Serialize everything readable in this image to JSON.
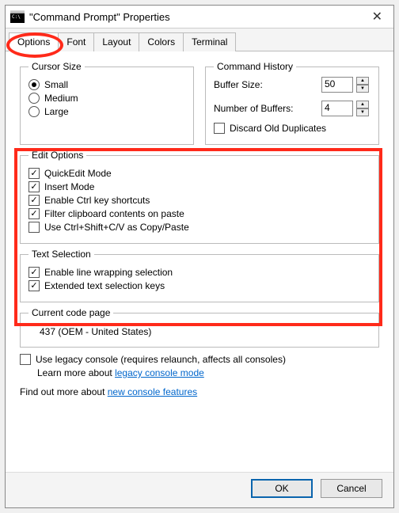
{
  "window": {
    "title": "\"Command Prompt\" Properties"
  },
  "tabs": {
    "options": "Options",
    "font": "Font",
    "layout": "Layout",
    "colors": "Colors",
    "terminal": "Terminal"
  },
  "cursor": {
    "legend": "Cursor Size",
    "small": "Small",
    "medium": "Medium",
    "large": "Large"
  },
  "history": {
    "legend": "Command History",
    "buffer_label": "Buffer Size:",
    "buffer_value": "50",
    "num_label": "Number of Buffers:",
    "num_value": "4",
    "discard": "Discard Old Duplicates"
  },
  "edit": {
    "legend": "Edit Options",
    "quickedit": "QuickEdit Mode",
    "insert": "Insert Mode",
    "ctrlkeys": "Enable Ctrl key shortcuts",
    "filter": "Filter clipboard contents on paste",
    "ctrlshift": "Use Ctrl+Shift+C/V as Copy/Paste"
  },
  "textsel": {
    "legend": "Text Selection",
    "wrap": "Enable line wrapping selection",
    "extended": "Extended text selection keys"
  },
  "codepage": {
    "legend": "Current code page",
    "value": "437   (OEM - United States)"
  },
  "legacy": {
    "checkbox": "Use legacy console (requires relaunch, affects all consoles)",
    "learn_prefix": "Learn more about ",
    "learn_link": "legacy console mode"
  },
  "bottom": {
    "find_prefix": "Find out more about ",
    "find_link": "new console features"
  },
  "buttons": {
    "ok": "OK",
    "cancel": "Cancel"
  }
}
